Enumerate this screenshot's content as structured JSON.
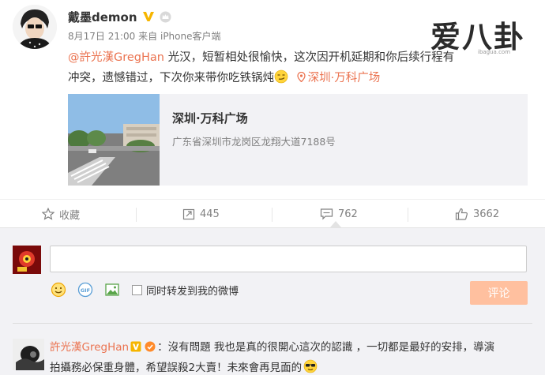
{
  "post": {
    "author": "戴墨demon",
    "date": "8月17日 21:00",
    "source_prefix": "来自",
    "source": "iPhone客户端",
    "mention": "@許光漢GregHan",
    "text_part": " 光汉，短暂相处很愉快，这次因开机延期和你后续行程有冲突，遗憾错过，下次你来带你吃铁锅炖",
    "location_link": "深圳·万科广场"
  },
  "watermark": {
    "text": "爱八卦",
    "sub": "ibagua.com"
  },
  "place_card": {
    "title": "深圳·万科广场",
    "address": "广东省深圳市龙岗区龙翔大道7188号"
  },
  "actions": {
    "favorite": "收藏",
    "repost": "445",
    "comment": "762",
    "like": "3662"
  },
  "comment_box": {
    "repost_checkbox_label": "同时转发到我的微博",
    "submit_label": "评论"
  },
  "reply": {
    "name": "許光漢GregHan",
    "line1": "：沒有問題 我也是真的很開心這次的認識 ，一切都是最好的安排，導演",
    "line2": "拍攝務必保重身體，希望誤殺2大賣！未來會再見面的"
  },
  "colors": {
    "accent": "#eb7350",
    "submit_bg": "#ffc09f",
    "comment_bg": "#f2f2f5",
    "verified": "#f6b500"
  }
}
